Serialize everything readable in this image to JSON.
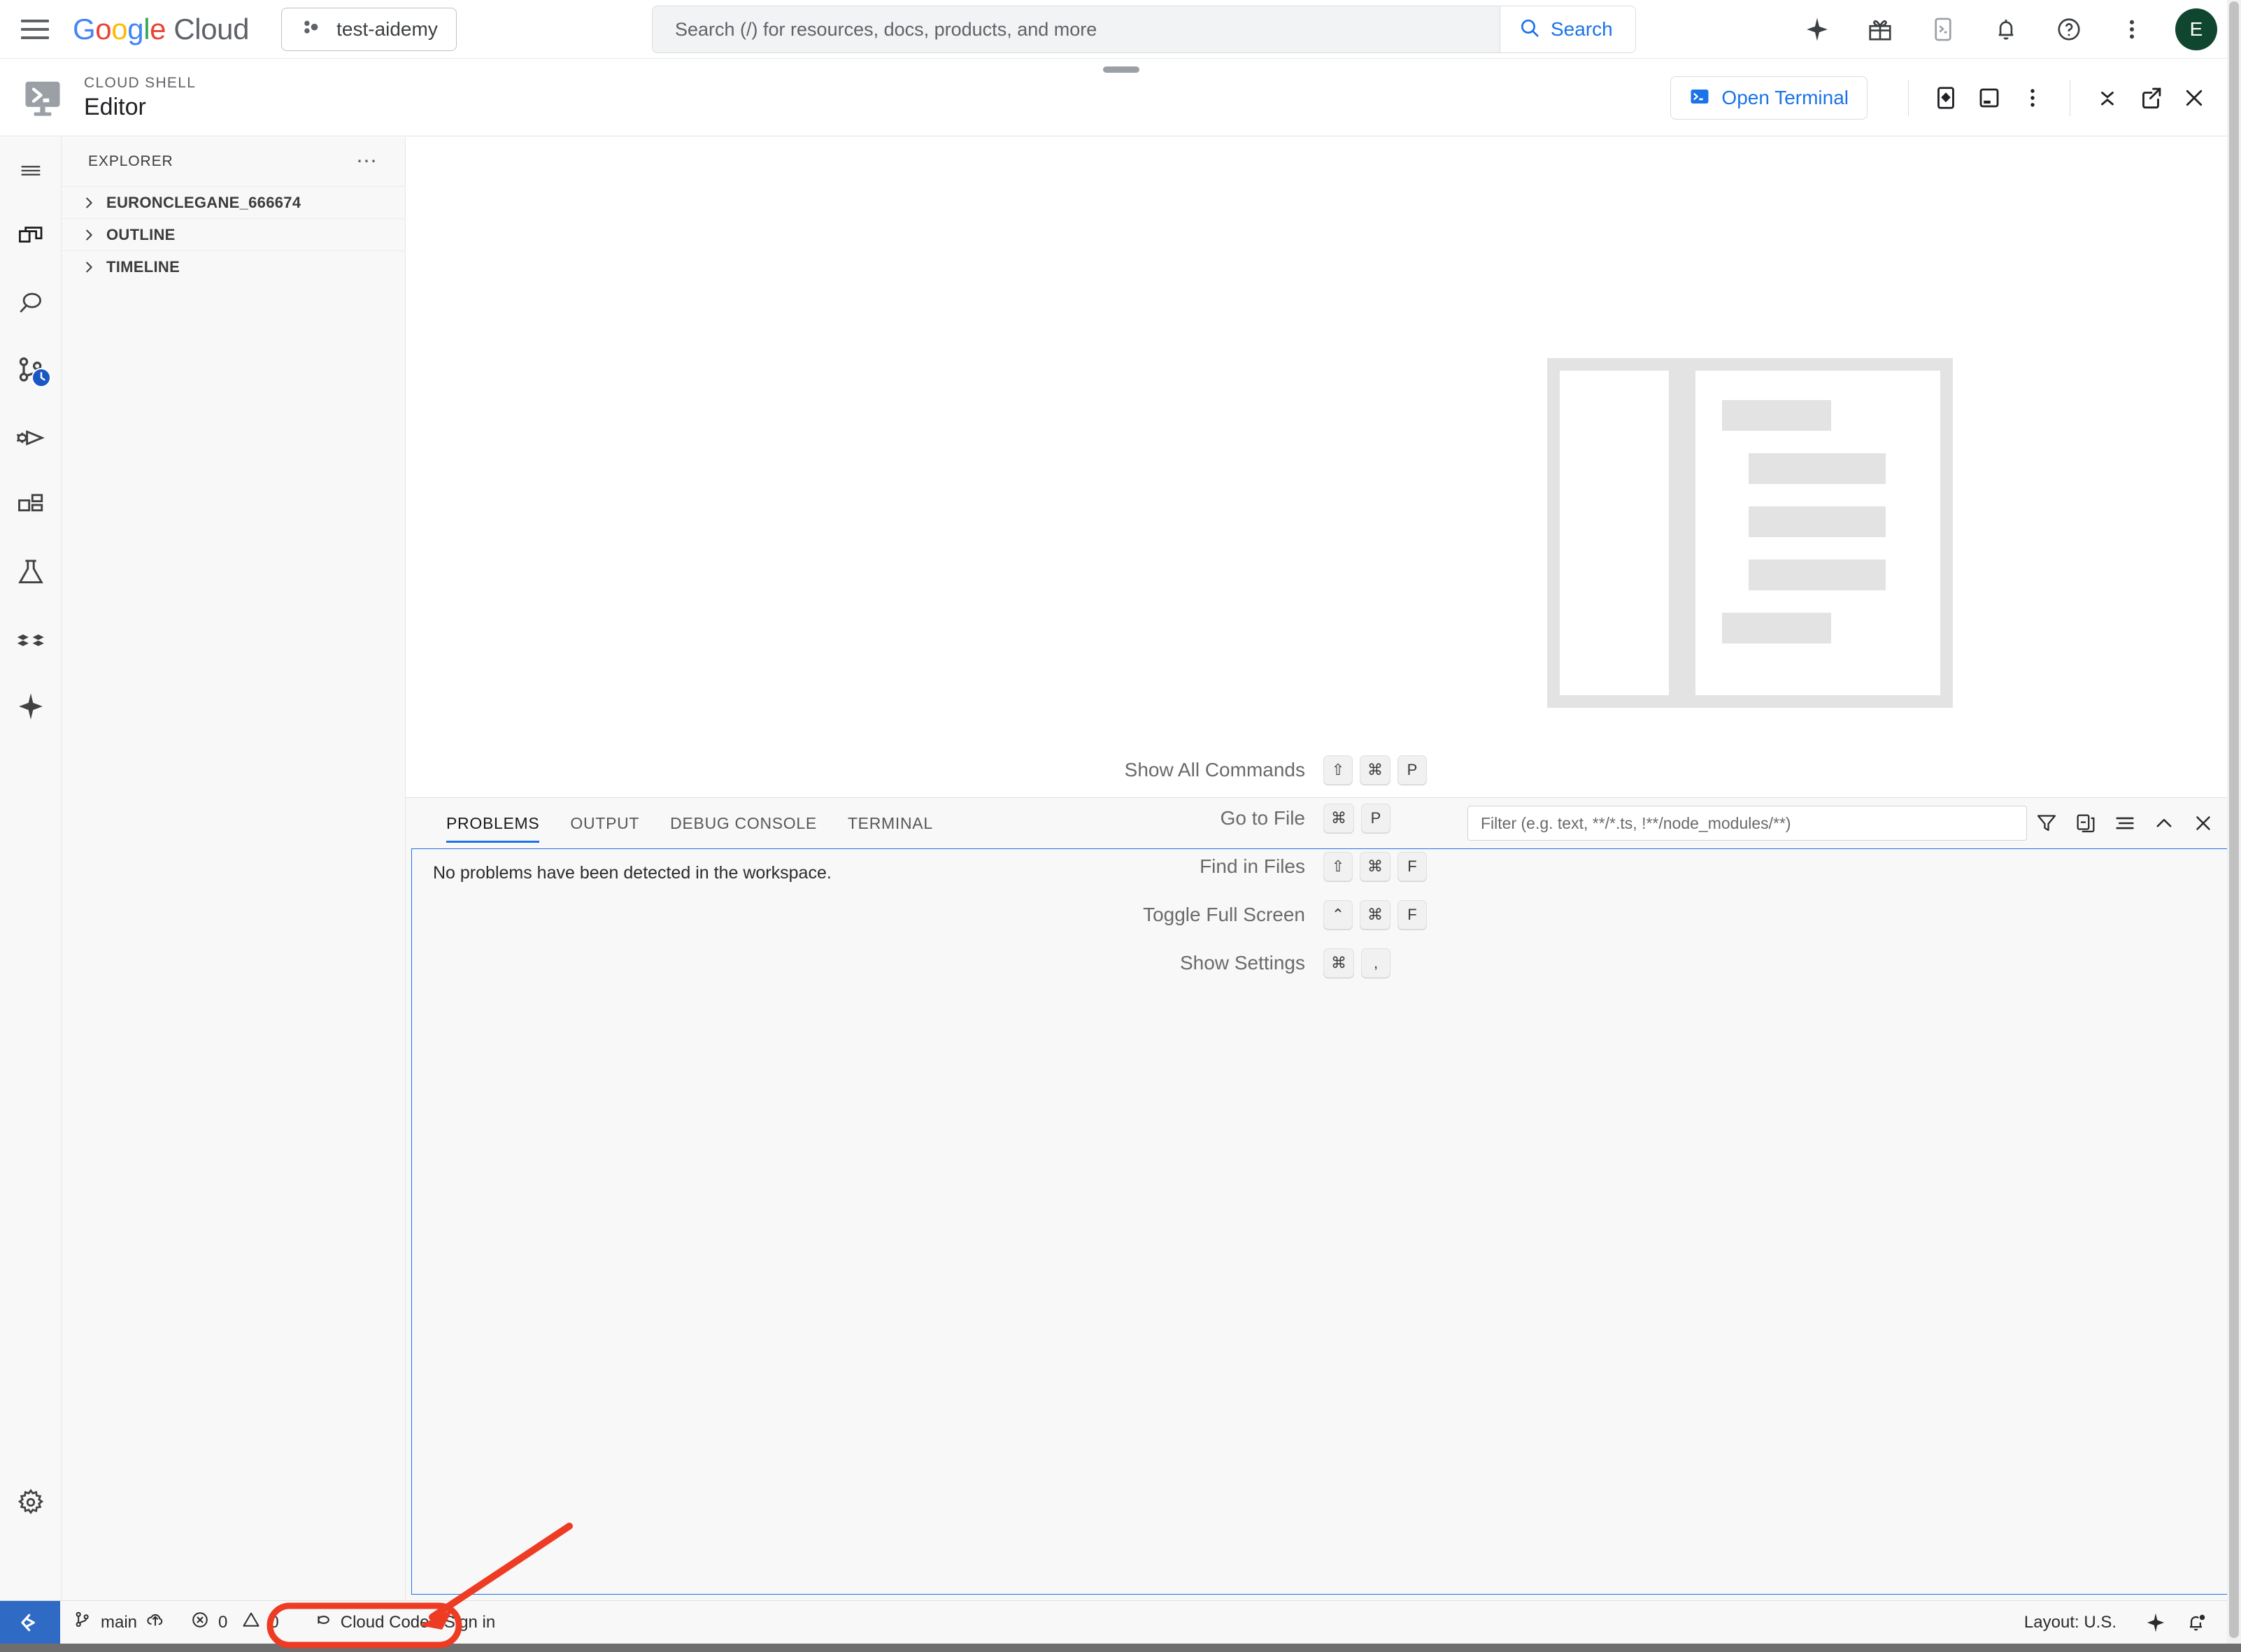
{
  "topbar": {
    "menu_icon": "hamburger-menu-icon",
    "logo_text": "Google Cloud",
    "project": {
      "name": "test-aidemy",
      "icon": "project-dots-icon"
    },
    "search": {
      "placeholder": "Search (/) for resources, docs, products, and more",
      "button_label": "Search",
      "icon": "search-icon"
    },
    "actions": [
      {
        "name": "gemini-sparkle-icon",
        "label": "Gemini"
      },
      {
        "name": "gift-icon",
        "label": "Offers"
      },
      {
        "name": "cloud-shell-icon",
        "label": "Activate Cloud Shell"
      },
      {
        "name": "bell-icon",
        "label": "Notifications"
      },
      {
        "name": "help-icon",
        "label": "Help"
      },
      {
        "name": "more-vert-icon",
        "label": "More options"
      }
    ],
    "avatar_initial": "E",
    "avatar_color": "#10462f"
  },
  "cloud_shell": {
    "eyebrow": "CLOUD SHELL",
    "title": "Editor",
    "open_terminal_label": "Open Terminal",
    "actions": [
      {
        "name": "preview-web-icon",
        "label": "Web Preview"
      },
      {
        "name": "new-terminal-icon",
        "label": "New Terminal"
      },
      {
        "name": "more-vert-icon",
        "label": "More"
      },
      {
        "name": "minimize-icon",
        "label": "Minimize"
      },
      {
        "name": "open-new-window-icon",
        "label": "Open in new window"
      },
      {
        "name": "close-icon",
        "label": "Close"
      }
    ]
  },
  "activity_bar": [
    {
      "name": "hamburger-menu-icon",
      "label": "Menu"
    },
    {
      "name": "explorer-files-icon",
      "label": "Explorer"
    },
    {
      "name": "search-icon",
      "label": "Search"
    },
    {
      "name": "source-control-icon",
      "label": "Source Control",
      "badge": "clock-badge"
    },
    {
      "name": "run-debug-icon",
      "label": "Run and Debug"
    },
    {
      "name": "extensions-icon",
      "label": "Extensions"
    },
    {
      "name": "testing-flask-icon",
      "label": "Testing"
    },
    {
      "name": "cloud-code-icon",
      "label": "Cloud Code"
    },
    {
      "name": "gemini-sparkle-icon",
      "label": "Gemini Code Assist"
    }
  ],
  "activity_bar_bottom": {
    "name": "settings-gear-icon",
    "label": "Manage"
  },
  "sidebar": {
    "header": "EXPLORER",
    "more_actions_icon": "ellipsis-icon",
    "sections": [
      {
        "label": "EURONCLEGANE_666674",
        "expanded": false
      },
      {
        "label": "OUTLINE",
        "expanded": false
      },
      {
        "label": "TIMELINE",
        "expanded": false
      }
    ]
  },
  "welcome": {
    "shortcuts": [
      {
        "label": "Show All Commands",
        "keys": [
          "⇧",
          "⌘",
          "P"
        ]
      },
      {
        "label": "Go to File",
        "keys": [
          "⌘",
          "P"
        ]
      },
      {
        "label": "Find in Files",
        "keys": [
          "⇧",
          "⌘",
          "F"
        ]
      },
      {
        "label": "Toggle Full Screen",
        "keys": [
          "⌃",
          "⌘",
          "F"
        ]
      },
      {
        "label": "Show Settings",
        "keys": [
          "⌘",
          ","
        ]
      }
    ]
  },
  "panel": {
    "tabs": [
      {
        "label": "PROBLEMS",
        "active": true
      },
      {
        "label": "OUTPUT",
        "active": false
      },
      {
        "label": "DEBUG CONSOLE",
        "active": false
      },
      {
        "label": "TERMINAL",
        "active": false
      }
    ],
    "filter_placeholder": "Filter (e.g. text, **/*.ts, !**/node_modules/**)",
    "tools": [
      {
        "name": "filter-funnel-icon",
        "label": "Filter"
      },
      {
        "name": "collapse-all-icon",
        "label": "Collapse All"
      },
      {
        "name": "view-as-list-icon",
        "label": "View as List"
      },
      {
        "name": "chevron-up-icon",
        "label": "Maximize Panel Size"
      },
      {
        "name": "close-icon",
        "label": "Close Panel"
      }
    ],
    "empty_message": "No problems have been detected in the workspace.",
    "border_color": "#1a73e8"
  },
  "status_bar": {
    "remote_icon": "remote-window-icon",
    "branch": {
      "icon": "source-control-branch-icon",
      "label": "main",
      "sync_icon": "sync-cloud-icon"
    },
    "diagnostics": {
      "error_icon": "error-circle-icon",
      "errors": "0",
      "warning_icon": "warning-triangle-icon",
      "warnings": "0"
    },
    "cloud_code": {
      "icon": "cloud-code-status-icon",
      "label": "Cloud Code - Sign in"
    },
    "layout": "Layout: U.S.",
    "right_icons": [
      {
        "name": "gemini-sparkle-icon",
        "label": "Gemini"
      },
      {
        "name": "notification-bell-dot-icon",
        "label": "Notifications"
      }
    ]
  },
  "annotation": {
    "color": "#ee3b24",
    "highlight_target": "Cloud Code - Sign in",
    "shape": "arrow-pointing-to-ellipse"
  }
}
